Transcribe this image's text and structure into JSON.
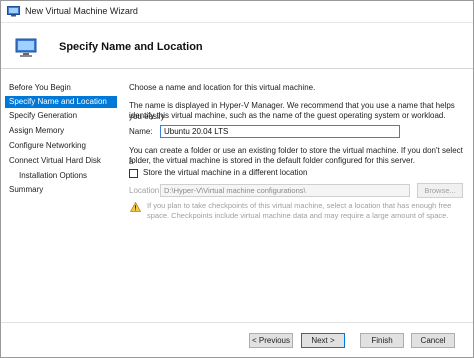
{
  "window": {
    "title": "New Virtual Machine Wizard"
  },
  "header": {
    "title": "Specify Name and Location"
  },
  "sidebar": {
    "items": [
      {
        "label": "Before You Begin",
        "active": false,
        "sub": false
      },
      {
        "label": "Specify Name and Location",
        "active": true,
        "sub": false
      },
      {
        "label": "Specify Generation",
        "active": false,
        "sub": false
      },
      {
        "label": "Assign Memory",
        "active": false,
        "sub": false
      },
      {
        "label": "Configure Networking",
        "active": false,
        "sub": false
      },
      {
        "label": "Connect Virtual Hard Disk",
        "active": false,
        "sub": false
      },
      {
        "label": "Installation Options",
        "active": false,
        "sub": true
      },
      {
        "label": "Summary",
        "active": false,
        "sub": false
      }
    ]
  },
  "content": {
    "intro": "Choose a name and location for this virtual machine.",
    "description_line1": "The name is displayed in Hyper-V Manager. We recommend that you use a name that helps you easily",
    "description_line2": "identify this virtual machine, such as the name of the guest operating system or workload.",
    "name_label": "Name:",
    "name_value": "Ubuntu 20.04 LTS",
    "folder_line1": "You can create a folder or use an existing folder to store the virtual machine. If you don't select a",
    "folder_line2": "folder, the virtual machine is stored in the default folder configured for this server.",
    "store_checkbox_label": "Store the virtual machine in a different location",
    "store_checked": false,
    "location_label": "Location:",
    "location_value": "D:\\Hyper-V\\Virtual machine configurations\\",
    "browse_label": "Browse...",
    "warning_line1": "If you plan to take checkpoints of this virtual machine, select a location that has enough free",
    "warning_line2": "space. Checkpoints include virtual machine data and may require a large amount of space."
  },
  "footer": {
    "previous_label": "< Previous",
    "next_label": "Next >",
    "finish_label": "Finish",
    "cancel_label": "Cancel"
  },
  "colors": {
    "accent": "#0078d7",
    "disabled_text": "#a0a0a0"
  }
}
